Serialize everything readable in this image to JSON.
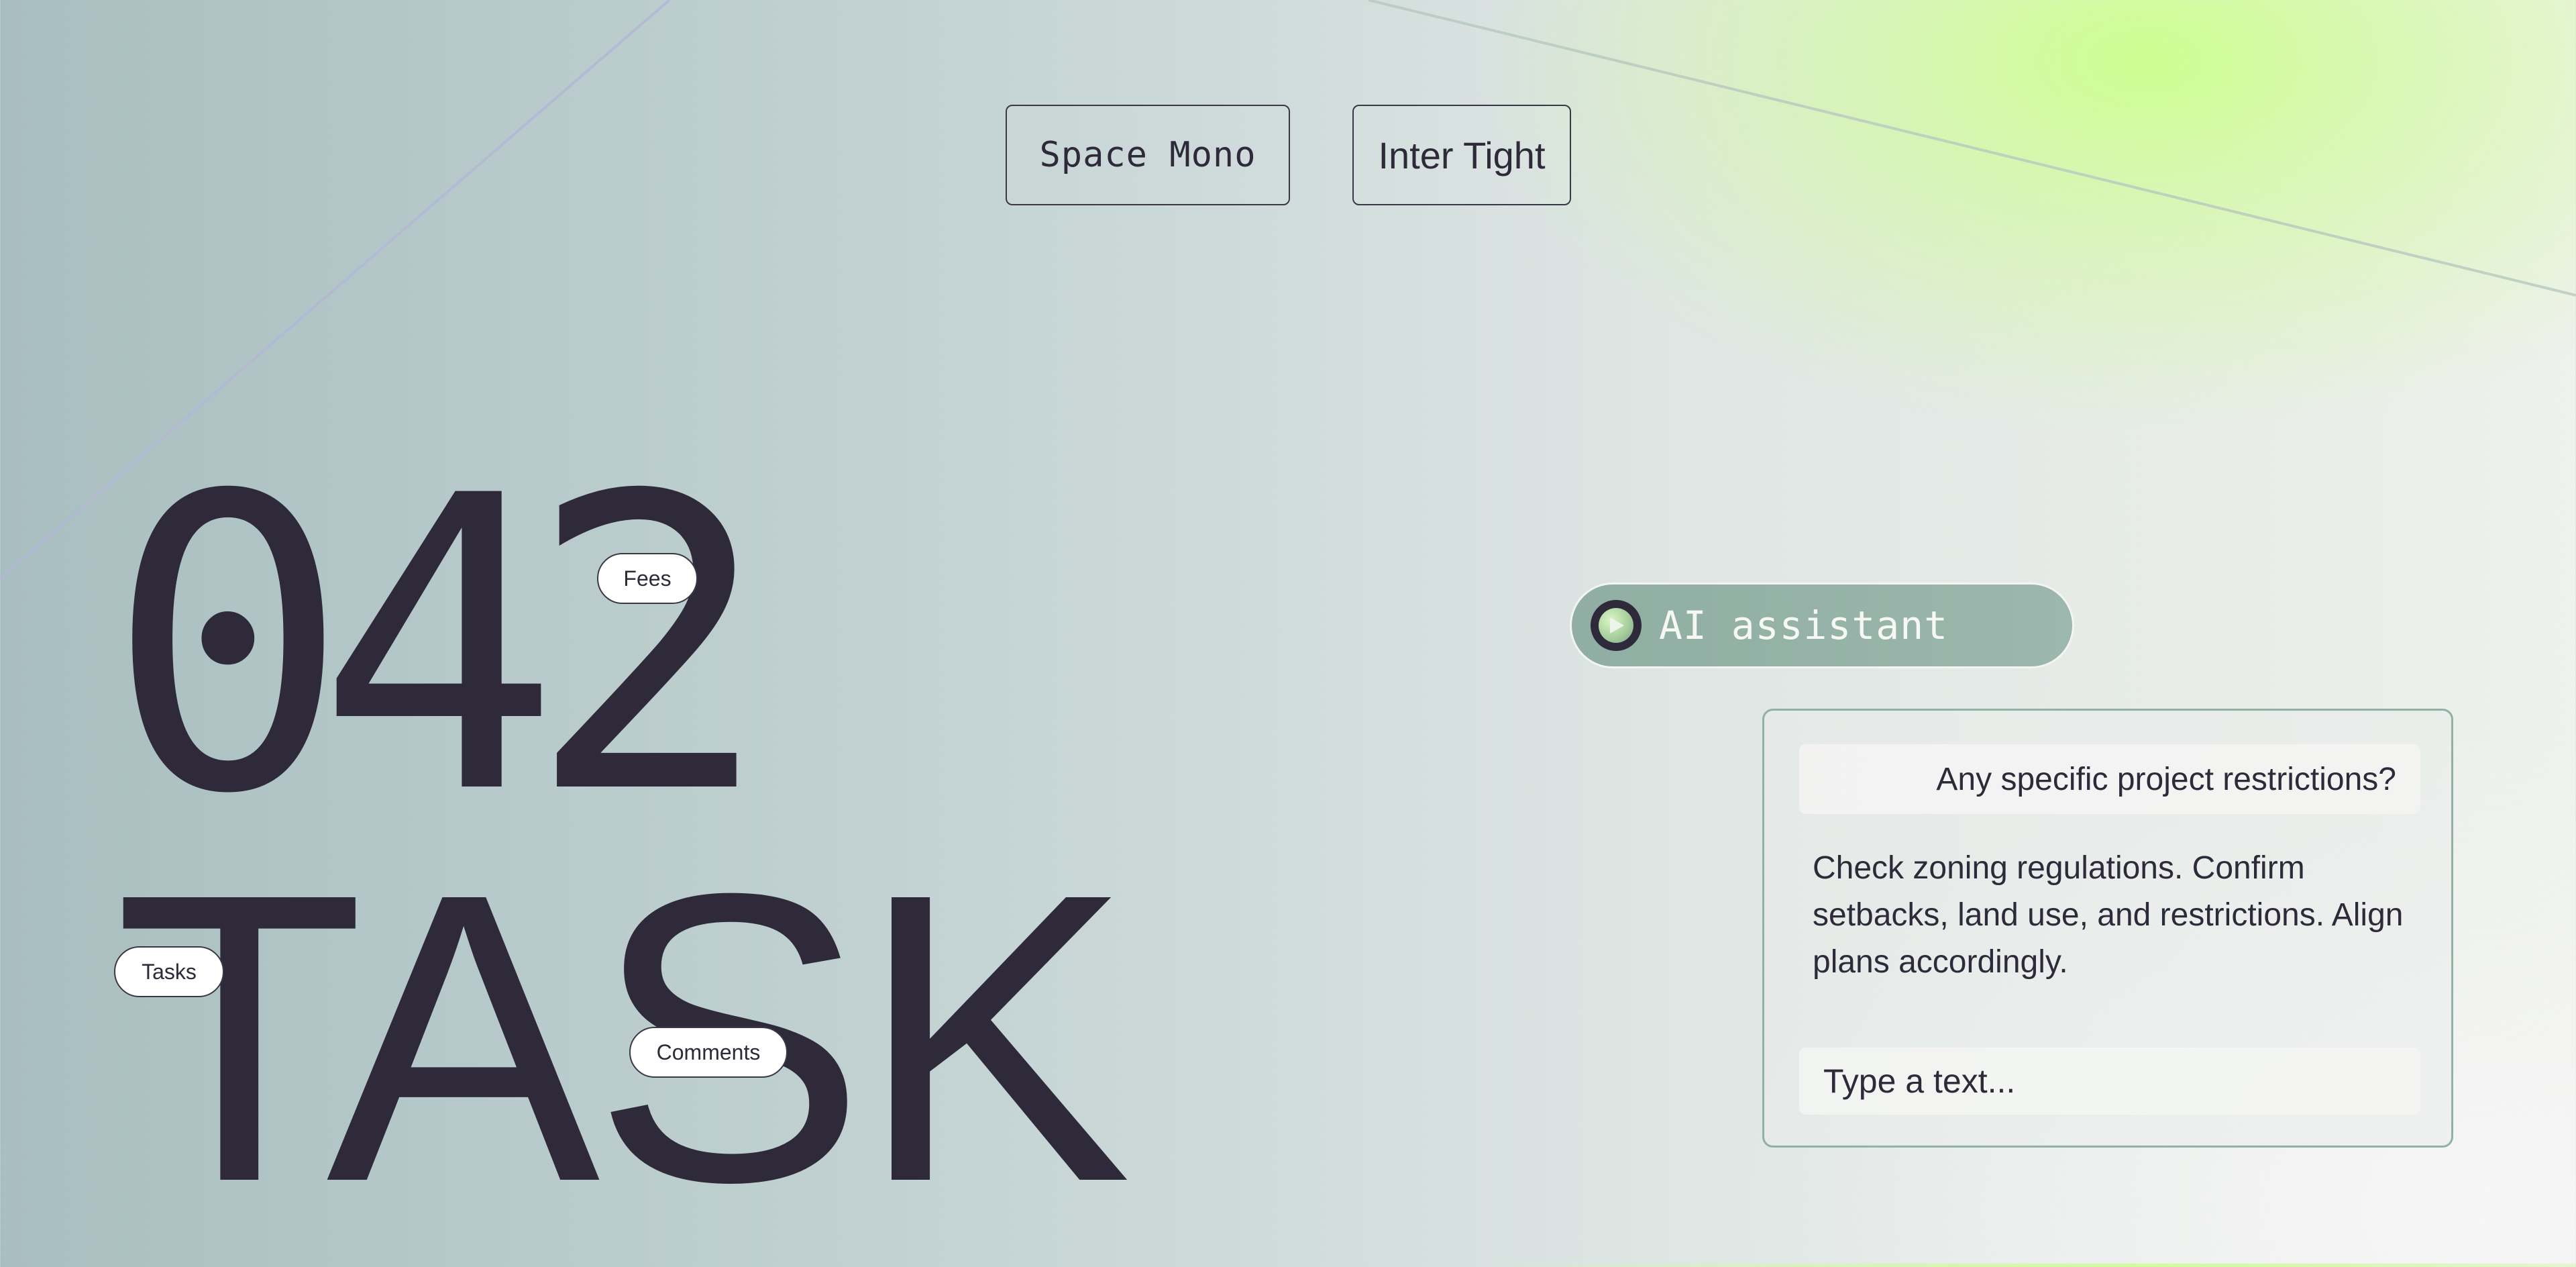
{
  "font_options": [
    {
      "label": "Space Mono"
    },
    {
      "label": "Inter Tight"
    }
  ],
  "display": {
    "number": "042",
    "word": "TASK"
  },
  "tags": {
    "fees": "Fees",
    "tasks": "Tasks",
    "comments": "Comments"
  },
  "assistant": {
    "label": "AI assistant",
    "icon": "play-icon"
  },
  "chat": {
    "user_message": "Any specific project restrictions?",
    "ai_message": "Check zoning regulations. Confirm setbacks, land use, and restrictions. Align plans accordingly.",
    "input_placeholder": "Type a text..."
  },
  "colors": {
    "ink": "#2e2a3a",
    "accent_green": "#ccff8c",
    "assistant_pill": "#9cb7ad",
    "panel_border": "#91b0a6"
  }
}
